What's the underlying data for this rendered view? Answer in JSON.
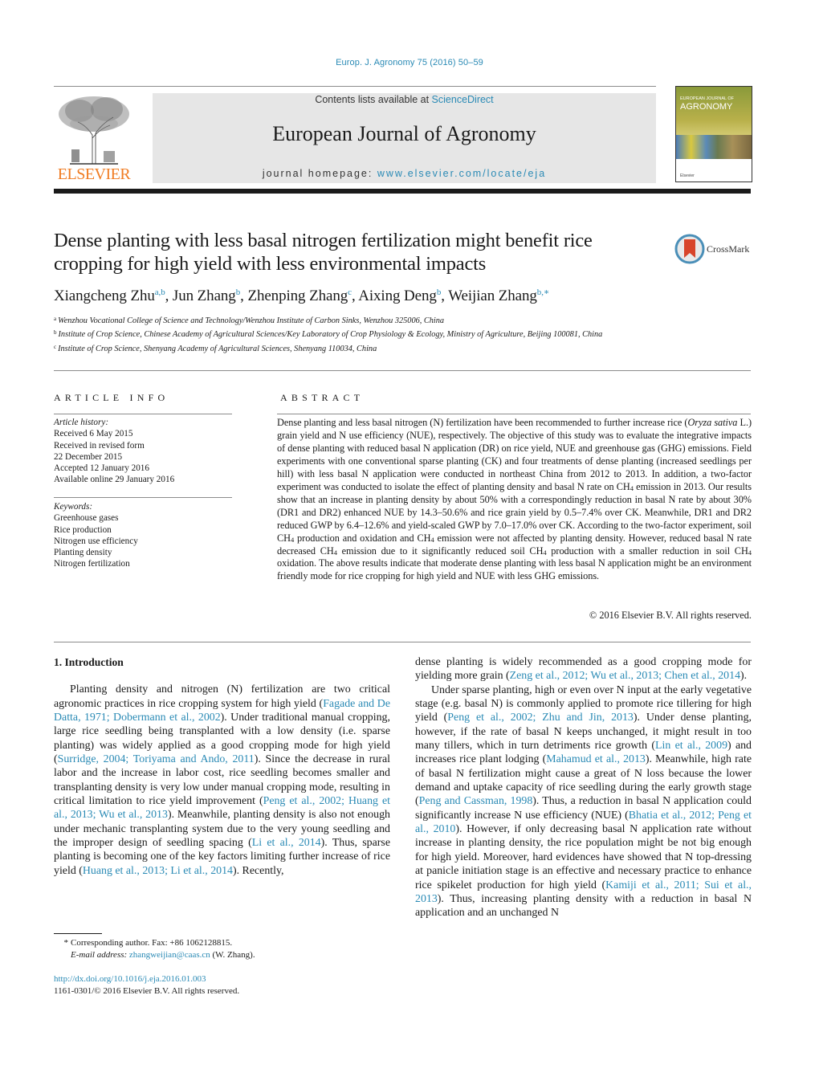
{
  "header": {
    "citation": "Europ. J. Agronomy 75 (2016) 50–59",
    "publisher_logo": "ELSEVIER",
    "contents_prefix": "Contents lists available at ",
    "contents_link": "ScienceDirect",
    "journal_title": "European Journal of Agronomy",
    "homepage_prefix": "journal homepage: ",
    "homepage_link": "www.elsevier.com/locate/eja",
    "cover": {
      "line1": "EUROPEAN JOURNAL OF",
      "line2": "AGRONOMY",
      "footer": "Elsevier"
    }
  },
  "article": {
    "title": "Dense planting with less basal nitrogen fertilization might benefit rice cropping for high yield with less environmental impacts",
    "crossmark_label": "CrossMark",
    "authors": [
      {
        "name": "Xiangcheng Zhu",
        "sup": "a,b",
        "sep": ", "
      },
      {
        "name": "Jun Zhang",
        "sup": "b",
        "sep": ", "
      },
      {
        "name": "Zhenping Zhang",
        "sup": "c",
        "sep": ", "
      },
      {
        "name": "Aixing Deng",
        "sup": "b",
        "sep": ", "
      },
      {
        "name": "Weijian Zhang",
        "sup": "b,∗",
        "sep": ""
      }
    ],
    "affiliations": [
      {
        "key": "a",
        "text": "Wenzhou Vocational College of Science and Technology/Wenzhou Institute of Carbon Sinks, Wenzhou 325006, China"
      },
      {
        "key": "b",
        "text": "Institute of Crop Science, Chinese Academy of Agricultural Sciences/Key Laboratory of Crop Physiology & Ecology, Ministry of Agriculture, Beijing 100081, China"
      },
      {
        "key": "c",
        "text": "Institute of Crop Science, Shenyang Academy of Agricultural Sciences, Shenyang 110034, China"
      }
    ]
  },
  "article_info": {
    "heading": "ARTICLE INFO",
    "history_label": "Article history:",
    "history": [
      "Received 6 May 2015",
      "Received in revised form",
      "22 December 2015",
      "Accepted 12 January 2016",
      "Available online 29 January 2016"
    ],
    "keywords_label": "Keywords:",
    "keywords": [
      "Greenhouse gases",
      "Rice production",
      "Nitrogen use efficiency",
      "Planting density",
      "Nitrogen fertilization"
    ]
  },
  "abstract": {
    "heading": "ABSTRACT",
    "segments": [
      {
        "t": "Dense planting and less basal nitrogen (N) fertilization have been recommended to further increase rice ("
      },
      {
        "t": "Oryza sativa",
        "style": "i"
      },
      {
        "t": " L.) grain yield and N use efficiency (NUE), respectively. The objective of this study was to evaluate the integrative impacts of dense planting with reduced basal N application (DR) on rice yield, NUE and greenhouse gas (GHG) emissions. Field experiments with one conventional sparse planting (CK) and four treatments of dense planting (increased seedlings per hill) with less basal N application were conducted in northeast China from 2012 to 2013. In addition, a two-factor experiment was conducted to isolate the effect of planting density and basal N rate on CH"
      },
      {
        "t": "4",
        "style": "sub"
      },
      {
        "t": " emission in 2013. Our results show that an increase in planting density by about 50% with a correspondingly reduction in basal N rate by about 30% (DR1 and DR2) enhanced NUE by 14.3–50.6% and rice grain yield by 0.5–7.4% over CK. Meanwhile, DR1 and DR2 reduced GWP by 6.4–12.6% and yield-scaled GWP by 7.0–17.0% over CK. According to the two-factor experiment, soil CH"
      },
      {
        "t": "4",
        "style": "sub"
      },
      {
        "t": " production and oxidation and CH"
      },
      {
        "t": "4",
        "style": "sub"
      },
      {
        "t": " emission were not affected by planting density. However, reduced basal N rate decreased CH"
      },
      {
        "t": "4",
        "style": "sub"
      },
      {
        "t": " emission due to it significantly reduced soil CH"
      },
      {
        "t": "4",
        "style": "sub"
      },
      {
        "t": " production with a smaller reduction in soil CH"
      },
      {
        "t": "4",
        "style": "sub"
      },
      {
        "t": " oxidation. The above results indicate that moderate dense planting with less basal N application might be an environment friendly mode for rice cropping for high yield and NUE with less GHG emissions."
      }
    ],
    "copyright": "© 2016 Elsevier B.V. All rights reserved."
  },
  "body": {
    "section_heading": "1.  Introduction",
    "left_paragraphs": [
      [
        {
          "t": "Planting density and nitrogen (N) fertilization are two critical agronomic practices in rice cropping system for high yield ("
        },
        {
          "t": "Fagade and De Datta, 1971; Dobermann et al., 2002",
          "link": true
        },
        {
          "t": "). Under traditional manual cropping, large rice seedling being transplanted with a low density (i.e. sparse planting) was widely applied as a good cropping mode for high yield ("
        },
        {
          "t": "Surridge, 2004; Toriyama and Ando, 2011",
          "link": true
        },
        {
          "t": "). Since the decrease in rural labor and the increase in labor cost, rice seedling becomes smaller and transplanting density is very low under manual cropping mode, resulting in critical limitation to rice yield improvement ("
        },
        {
          "t": "Peng et al., 2002; Huang et al., 2013; Wu et al., 2013",
          "link": true
        },
        {
          "t": "). Meanwhile, planting density is also not enough under mechanic transplanting system due to the very young seedling and the improper design of seedling spacing ("
        },
        {
          "t": "Li et al., 2014",
          "link": true
        },
        {
          "t": "). Thus, sparse planting is becoming one of the key factors limiting further increase of rice yield ("
        },
        {
          "t": "Huang et al., 2013; Li et al., 2014",
          "link": true
        },
        {
          "t": "). Recently,"
        }
      ]
    ],
    "right_paragraphs": [
      [
        {
          "t": "dense planting is widely recommended as a good cropping mode for yielding more grain ("
        },
        {
          "t": "Zeng et al., 2012; Wu et al., 2013; Chen et al., 2014",
          "link": true
        },
        {
          "t": ")."
        }
      ],
      [
        {
          "t": "Under sparse planting, high or even over N input at the early vegetative stage (e.g. basal N) is commonly applied to promote rice tillering for high yield ("
        },
        {
          "t": "Peng et al., 2002; Zhu and Jin, 2013",
          "link": true
        },
        {
          "t": "). Under dense planting, however, if the rate of basal N keeps unchanged, it might result in too many tillers, which in turn detriments rice growth ("
        },
        {
          "t": "Lin et al., 2009",
          "link": true
        },
        {
          "t": ") and increases rice plant lodging ("
        },
        {
          "t": "Mahamud et al., 2013",
          "link": true
        },
        {
          "t": "). Meanwhile, high rate of basal N fertilization might cause a great of N loss because the lower demand and uptake capacity of rice seedling during the early growth stage ("
        },
        {
          "t": "Peng and Cassman, 1998",
          "link": true
        },
        {
          "t": "). Thus, a reduction in basal N application could significantly increase N use efficiency (NUE) ("
        },
        {
          "t": "Bhatia et al., 2012; Peng et al., 2010",
          "link": true
        },
        {
          "t": "). However, if only decreasing basal N application rate without increase in planting density, the rice population might be not big enough for high yield. Moreover, hard evidences have showed that N top-dressing at panicle initiation stage is an effective and necessary practice to enhance rice spikelet production for high yield ("
        },
        {
          "t": "Kamiji et al., 2011; Sui et al., 2013",
          "link": true
        },
        {
          "t": "). Thus, increasing planting density with a reduction in basal N application and an unchanged N"
        }
      ]
    ]
  },
  "footnotes": {
    "star": "*",
    "corresponding": "Corresponding author. Fax: +86 1062128815.",
    "email_label": "E-mail address:",
    "email": "zhangweijian@caas.cn",
    "email_suffix": " (W. Zhang).",
    "doi": "http://dx.doi.org/10.1016/j.eja.2016.01.003",
    "issn": "1161-0301/© 2016 Elsevier B.V. All rights reserved."
  }
}
